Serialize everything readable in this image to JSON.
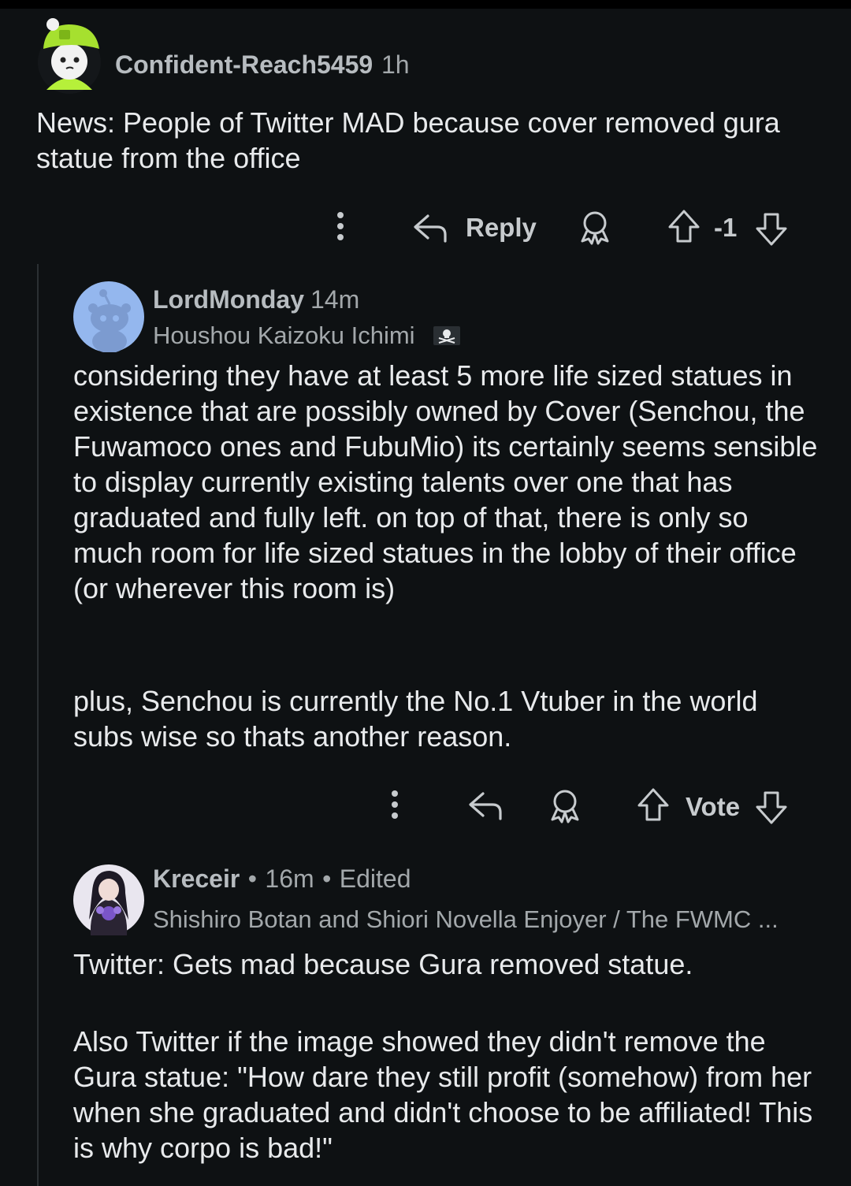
{
  "comments": [
    {
      "author": "Confident-Reach5459",
      "age": "1h",
      "text": "News: People of Twitter MAD because cover removed gura statue from the office",
      "actions": {
        "reply_label": "Reply",
        "score": "-1"
      }
    },
    {
      "author": "LordMonday",
      "age": "14m",
      "flair": "Houshou Kaizoku Ichimi",
      "paragraphs": [
        "considering they have at least 5 more life sized statues in existence that are possibly owned by Cover (Senchou, the Fuwamoco ones and FubuMio) its certainly seems sensible to display currently existing talents over one that has graduated and fully left. on top of that, there is only so much room for life sized statues in the lobby of their office (or wherever this room is)",
        "plus, Senchou is currently the No.1 Vtuber in the world subs wise so thats another reason."
      ],
      "actions": {
        "score": "Vote"
      }
    },
    {
      "author": "Kreceir",
      "separator": "•",
      "age": "16m",
      "edited": "Edited",
      "flair": "Shishiro Botan and Shiori Novella Enjoyer / The FWMC ...",
      "paragraphs": [
        "Twitter: Gets mad because Gura removed statue.",
        "Also Twitter if the image showed they didn't remove the Gura statue: \"How dare they still profit (somehow) from her when she graduated and didn't choose to be affiliated! This is why corpo is bad!\""
      ]
    }
  ],
  "icons": [
    "more-icon",
    "reply-icon",
    "award-icon",
    "upvote-icon",
    "downvote-icon",
    "pirate-flag-icon"
  ],
  "colors": {
    "background": "#0e1113",
    "text": "#e8eaec",
    "muted": "#a3a8ab",
    "avatar_blue": "#94b7ee"
  }
}
